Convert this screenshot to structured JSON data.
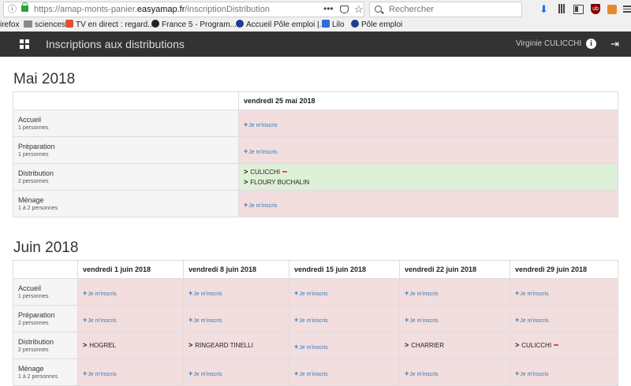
{
  "browser": {
    "url_prefix": "https://amap-monts-panier.",
    "url_domain": "easyamap.fr",
    "url_path": "/inscriptionDistribution",
    "search_placeholder": "Rechercher",
    "bookmarks": [
      "irefox",
      "sciences",
      "TV en direct : regard...",
      "France 5 - Program...",
      "Accueil Pôle emploi |...",
      "Lilo",
      "Pôle emploi"
    ]
  },
  "navbar": {
    "title": "Inscriptions aux distributions",
    "user": "Virginie CULICCHI"
  },
  "signup_label": "Je m'inscris",
  "may": {
    "month": "Mai 2018",
    "dates": [
      "vendredi 25 mai 2018"
    ],
    "roles": [
      {
        "name": "Accueil",
        "count": "1 personnes"
      },
      {
        "name": "Préparation",
        "count": "1 personnes"
      },
      {
        "name": "Distribution",
        "count": "2 personnes"
      },
      {
        "name": "Ménage",
        "count": "1 à 2 personnes"
      }
    ],
    "cells": [
      [
        "signup"
      ],
      [
        "signup"
      ],
      [
        [
          "CULICCHI",
          "FLOURY BUCHALIN"
        ]
      ],
      [
        "signup"
      ]
    ]
  },
  "june": {
    "month": "Juin 2018",
    "dates": [
      "vendredi 1 juin 2018",
      "vendredi 8 juin 2018",
      "vendredi 15 juin 2018",
      "vendredi 22 juin 2018",
      "vendredi 29 juin 2018"
    ],
    "roles": [
      {
        "name": "Accueil",
        "count": "1 personnes"
      },
      {
        "name": "Préparation",
        "count": "2 personnes"
      },
      {
        "name": "Distribution",
        "count": "2 personnes"
      },
      {
        "name": "Ménage",
        "count": "1 à 2 personnes"
      }
    ],
    "distribution_names": [
      "HOGREL",
      "RINGEARD TINELLI",
      "",
      "CHARRIER",
      "CULICCHI"
    ]
  }
}
